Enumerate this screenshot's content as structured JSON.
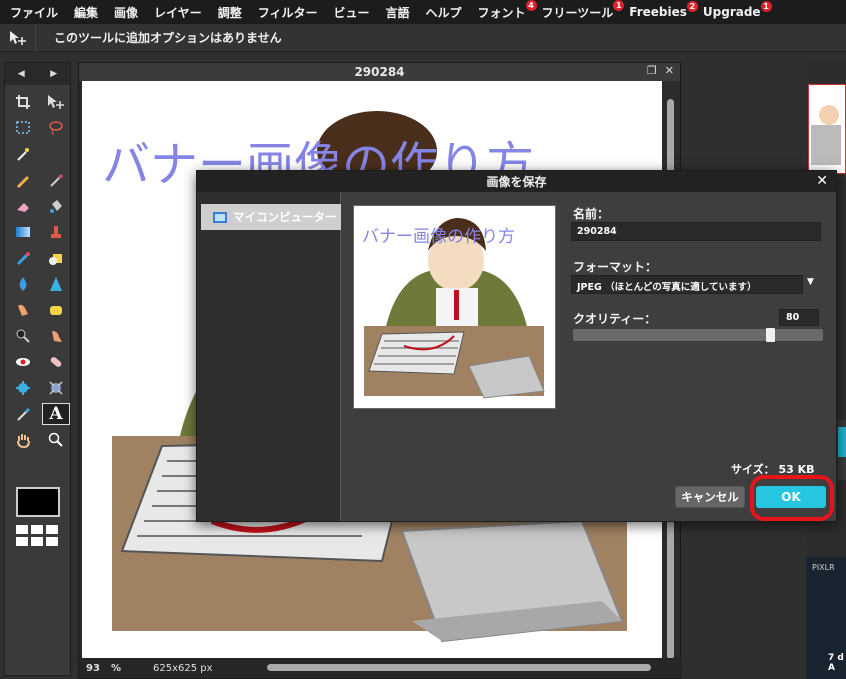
{
  "menu": [
    {
      "label": "ファイル",
      "badge": ""
    },
    {
      "label": "編集",
      "badge": ""
    },
    {
      "label": "画像",
      "badge": ""
    },
    {
      "label": "レイヤー",
      "badge": ""
    },
    {
      "label": "調整",
      "badge": ""
    },
    {
      "label": "フィルター",
      "badge": ""
    },
    {
      "label": "ビュー",
      "badge": ""
    },
    {
      "label": "言語",
      "badge": ""
    },
    {
      "label": "ヘルプ",
      "badge": ""
    },
    {
      "label": "フォント",
      "badge": "4"
    },
    {
      "label": "フリーツール",
      "badge": "1"
    },
    {
      "label": "Freebies",
      "badge": "2"
    },
    {
      "label": "Upgrade",
      "badge": "1"
    }
  ],
  "options_bar": {
    "message": "このツールに追加オプションはありません",
    "tool_icon": "move-tool-icon"
  },
  "toolbox": {
    "foreground_color": "#000000"
  },
  "document": {
    "title": "290284",
    "banner_text": "バナー画像の作り方",
    "zoom": "93",
    "zoom_unit": "%",
    "image_size": "625x625 px"
  },
  "dialog": {
    "title": "画像を保存",
    "source_item": "マイコンピューター",
    "preview_banner": "バナー画像の作り方",
    "name_label": "名前：",
    "name_value": "290284",
    "format_label": "フォーマット：",
    "format_value": "JPEG （ほとんどの写真に適しています）",
    "quality_label": "クオリティー：",
    "quality_value": "80",
    "quality_level": 80,
    "size_label": "サイズ：",
    "size_value": "53 KB",
    "cancel_label": "キャンセル",
    "ok_label": "OK"
  },
  "right_panel": {
    "ad_brand": "PIXLR",
    "ad_text": "7 d A"
  },
  "colors": {
    "accent": "#27c6e0",
    "highlight_ring": "#e8141c",
    "banner_text": "#8585e6",
    "badge": "#e0202a"
  }
}
